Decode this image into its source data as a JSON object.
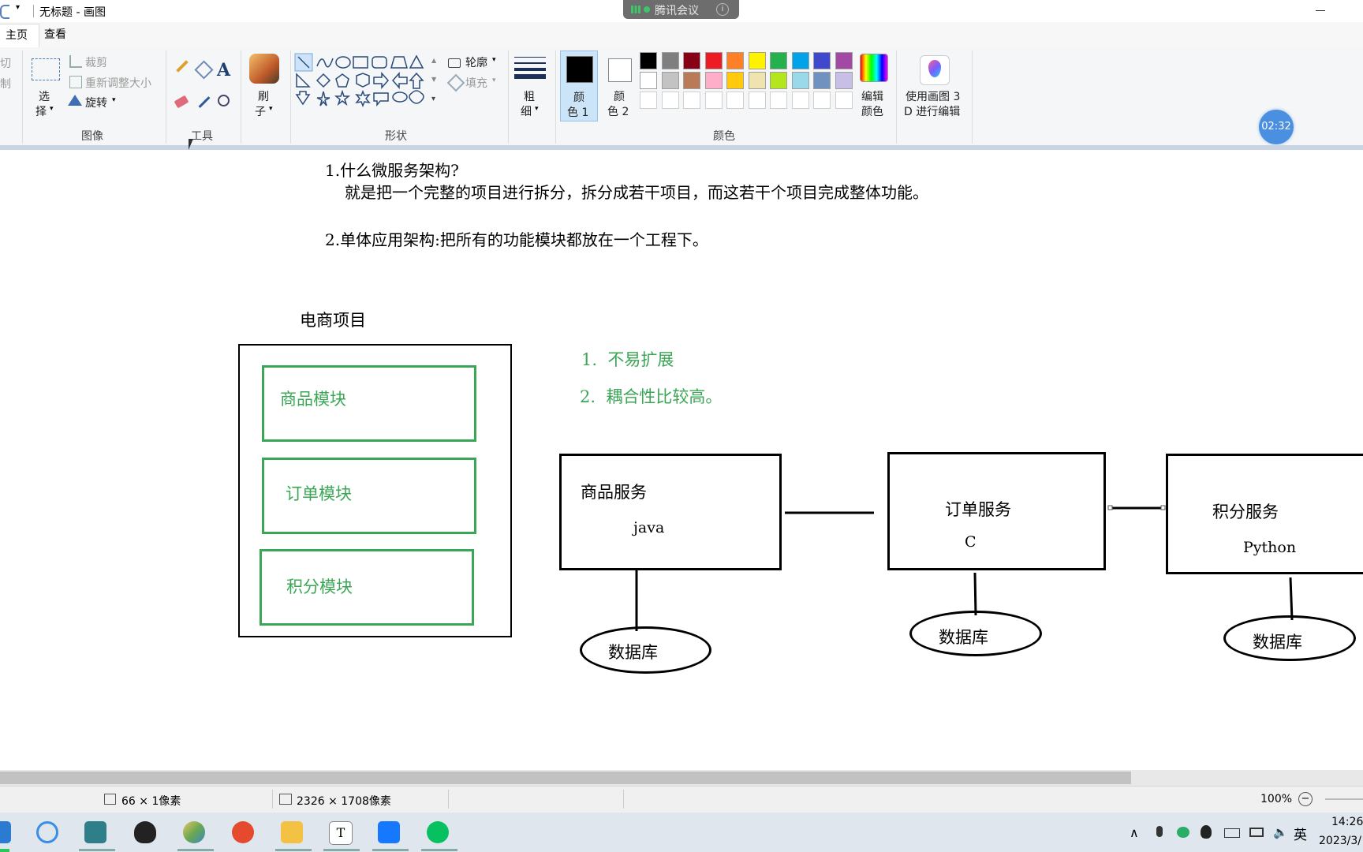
{
  "window": {
    "title": "无标题 - 画图",
    "min_icon": "minimize-icon",
    "qat_icon": "customize-arrow-icon"
  },
  "meeting": {
    "label": "腾讯会议",
    "info_icon": "info-icon"
  },
  "tabs": [
    {
      "label": "主页"
    },
    {
      "label": "查看"
    }
  ],
  "ribbon": {
    "clipboard": {
      "cut": "剪切",
      "copy": "复制"
    },
    "image": {
      "select_line1": "选",
      "select_line2": "择",
      "crop": "裁剪",
      "resize": "重新调整大小",
      "rotate": "旋转",
      "group_label": "图像"
    },
    "tools": {
      "group_label": "工具"
    },
    "brush": {
      "line1": "刷",
      "line2": "子"
    },
    "shapes": {
      "outline": "轮廓",
      "fill": "填充",
      "group_label": "形状"
    },
    "size": {
      "line1": "粗",
      "line2": "细"
    },
    "colors": {
      "color1_line1": "颜",
      "color1_line2": "色 1",
      "color2_line1": "颜",
      "color2_line2": "色 2",
      "edit_line1": "编辑",
      "edit_line2": "颜色",
      "group_label": "颜色",
      "row1": [
        "#000000",
        "#7f7f7f",
        "#880015",
        "#ed1c24",
        "#ff7f27",
        "#fff200",
        "#22b14c",
        "#00a2e8",
        "#3f48cc",
        "#a349a4"
      ],
      "row2": [
        "#ffffff",
        "#c3c3c3",
        "#b97a57",
        "#ffaec9",
        "#ffc90e",
        "#efe4b0",
        "#b5e61d",
        "#99d9ea",
        "#7092be",
        "#c8bfe7"
      ],
      "color1": "#000000",
      "color2": "#ffffff"
    },
    "paint3d": {
      "line1": "使用画图 3",
      "line2": "D 进行编辑"
    }
  },
  "timer": "02:32",
  "canvas": {
    "q1": "1.什么微服务架构?",
    "q1_answer": "就是把一个完整的项目进行拆分，拆分成若干项目，而这若干个项目完成整体功能。",
    "q2": "2.单体应用架构:把所有的功能模块都放在一个工程下。",
    "monolith_title": "电商项目",
    "modules": [
      "商品模块",
      "订单模块",
      "积分模块"
    ],
    "drawbacks": [
      "1.  不易扩展",
      "2.  耦合性比较高。"
    ],
    "services": [
      {
        "name": "商品服务",
        "lang": "java"
      },
      {
        "name": "订单服务",
        "lang": "C"
      },
      {
        "name": "积分服务",
        "lang": "Python"
      }
    ],
    "database_label": "数据库"
  },
  "status": {
    "cursor_size": "66 × 1像素",
    "image_size": "2326 × 1708像素",
    "zoom": "100%"
  },
  "taskbar": {
    "ime": "英",
    "time": "14:26",
    "date": "2023/3/"
  }
}
